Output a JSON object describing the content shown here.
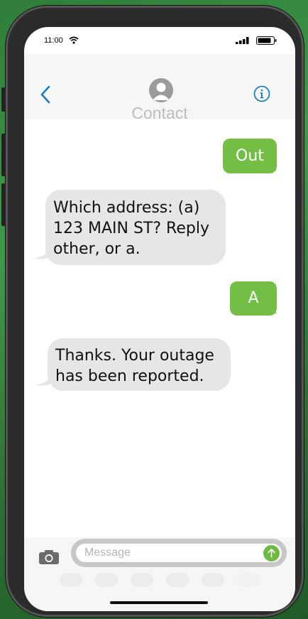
{
  "status_bar": {
    "time": "11:00"
  },
  "header": {
    "contact_name": "Contact"
  },
  "messages": [
    {
      "direction": "sent",
      "text": "Out"
    },
    {
      "direction": "received",
      "line1": "Which address: (a)",
      "line2": "123 MAIN ST? Reply",
      "line3": "other, or a."
    },
    {
      "direction": "sent",
      "text": "A"
    },
    {
      "direction": "received",
      "line1": "Thanks. Your outage",
      "line2": "has been reported."
    }
  ],
  "composer": {
    "placeholder": "Message"
  },
  "icons": {
    "back": "chevron-left-icon",
    "info": "info-icon",
    "camera": "camera-icon",
    "send": "arrow-up-icon"
  },
  "colors": {
    "sent_bubble": "#73bf45",
    "received_bubble": "#e6e6e6",
    "accent": "#1a7fc1",
    "send_button": "#6dbb40"
  }
}
